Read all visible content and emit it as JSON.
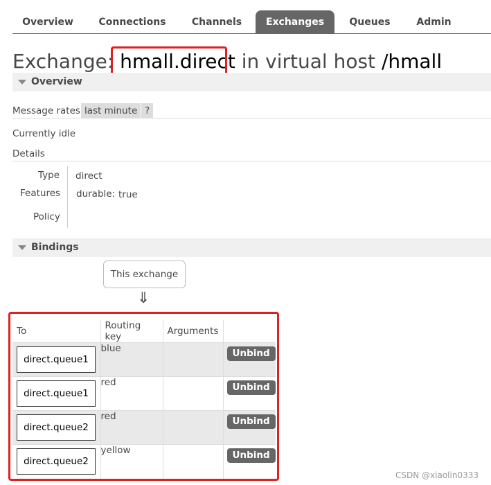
{
  "tabs": [
    "Overview",
    "Connections",
    "Channels",
    "Exchanges",
    "Queues",
    "Admin"
  ],
  "active_tab": "Exchanges",
  "title": {
    "prefix": "Exchange: ",
    "exchange_name": "hmall.direct",
    "middle": " in virtual host ",
    "vhost": "/hmall"
  },
  "overview": {
    "header": "Overview",
    "message_rates_label": "Message rates",
    "message_rates_value": "last minute",
    "help": "?",
    "status": "Currently idle",
    "details_label": "Details",
    "type_label": "Type",
    "type_value": "direct",
    "features_label": "Features",
    "durable_label": "durable:",
    "durable_value": "true",
    "policy_label": "Policy"
  },
  "bindings": {
    "header": "Bindings",
    "this_exchange": "This exchange",
    "arrow": "⇓",
    "columns": [
      "To",
      "Routing key",
      "Arguments",
      ""
    ],
    "rows": [
      {
        "to": "direct.queue1",
        "routing_key": "blue",
        "arguments": "",
        "action": "Unbind"
      },
      {
        "to": "direct.queue1",
        "routing_key": "red",
        "arguments": "",
        "action": "Unbind"
      },
      {
        "to": "direct.queue2",
        "routing_key": "red",
        "arguments": "",
        "action": "Unbind"
      },
      {
        "to": "direct.queue2",
        "routing_key": "yellow",
        "arguments": "",
        "action": "Unbind"
      }
    ]
  },
  "watermark": "CSDN @xiaolin0333",
  "colors": {
    "highlight": "#e0211f",
    "tab_active": "#666666"
  }
}
